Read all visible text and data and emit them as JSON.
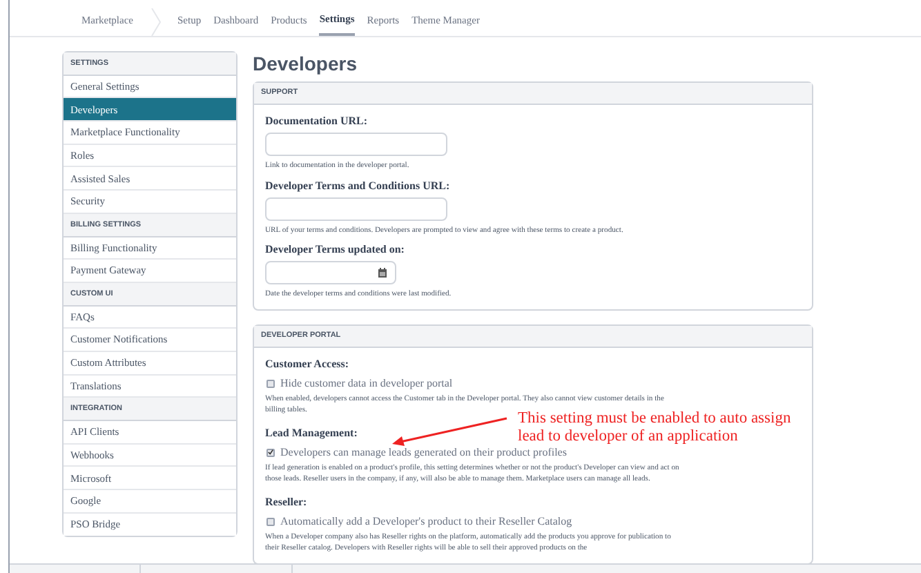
{
  "nav": {
    "brand": "Marketplace",
    "items": [
      {
        "label": "Setup",
        "selected": false
      },
      {
        "label": "Dashboard",
        "selected": false
      },
      {
        "label": "Products",
        "selected": false
      },
      {
        "label": "Settings",
        "selected": true
      },
      {
        "label": "Reports",
        "selected": false
      },
      {
        "label": "Theme Manager",
        "selected": false
      }
    ]
  },
  "sidebar": {
    "groups": [
      {
        "heading": "SETTINGS",
        "items": [
          {
            "label": "General Settings",
            "selected": false
          },
          {
            "label": "Developers",
            "selected": true
          },
          {
            "label": "Marketplace Functionality",
            "selected": false
          },
          {
            "label": "Roles",
            "selected": false
          },
          {
            "label": "Assisted Sales",
            "selected": false
          },
          {
            "label": "Security",
            "selected": false
          }
        ]
      },
      {
        "heading": "BILLING SETTINGS",
        "items": [
          {
            "label": "Billing Functionality",
            "selected": false
          },
          {
            "label": "Payment Gateway",
            "selected": false
          }
        ]
      },
      {
        "heading": "CUSTOM UI",
        "items": [
          {
            "label": "FAQs",
            "selected": false
          },
          {
            "label": "Customer Notifications",
            "selected": false
          },
          {
            "label": "Custom Attributes",
            "selected": false
          },
          {
            "label": "Translations",
            "selected": false
          }
        ]
      },
      {
        "heading": "INTEGRATION",
        "items": [
          {
            "label": "API Clients",
            "selected": false
          },
          {
            "label": "Webhooks",
            "selected": false
          },
          {
            "label": "Microsoft",
            "selected": false
          },
          {
            "label": "Google",
            "selected": false
          },
          {
            "label": "PSO Bridge",
            "selected": false
          }
        ]
      }
    ]
  },
  "page_title": "Developers",
  "sections": [
    {
      "heading": "SUPPORT",
      "fields": [
        {
          "kind": "text",
          "label": "Documentation URL:",
          "help": "Link to documentation in the developer portal."
        },
        {
          "kind": "text",
          "label": "Developer Terms and Conditions URL:",
          "help": "URL of your terms and conditions. Developers are prompted to view and agree with these terms to create a product."
        },
        {
          "kind": "date",
          "label": "Developer Terms updated on:",
          "help": "Date the developer terms and conditions were last modified."
        }
      ]
    },
    {
      "heading": "DEVELOPER PORTAL",
      "fields": [
        {
          "kind": "checkbox",
          "label": "Customer Access:",
          "option": "Hide customer data in developer portal",
          "checked": false,
          "help": "When enabled, developers cannot access the Customer tab in the Developer portal. They also cannot view customer details in the billing tables."
        },
        {
          "kind": "checkbox",
          "label": "Lead Management:",
          "option": "Developers can manage leads generated on their product profiles",
          "checked": true,
          "help": "If lead generation is enabled on a product's profile, this setting determines whether or not the product's Developer can view and act on those leads. Reseller users in the company, if any, will also be able to manage them. Marketplace users can manage all leads."
        },
        {
          "kind": "checkbox",
          "label": "Reseller:",
          "option": "Automatically add a Developer's product to their Reseller Catalog",
          "checked": false,
          "help": "When a Developer company also has Reseller rights on the platform, automatically add the products you approve for publication to their Reseller catalog. Developers with Reseller rights will be able to sell their approved products on the"
        }
      ]
    }
  ],
  "annotation": {
    "lines": [
      "This setting must be enabled to auto assign",
      "lead to developer of an application"
    ]
  }
}
